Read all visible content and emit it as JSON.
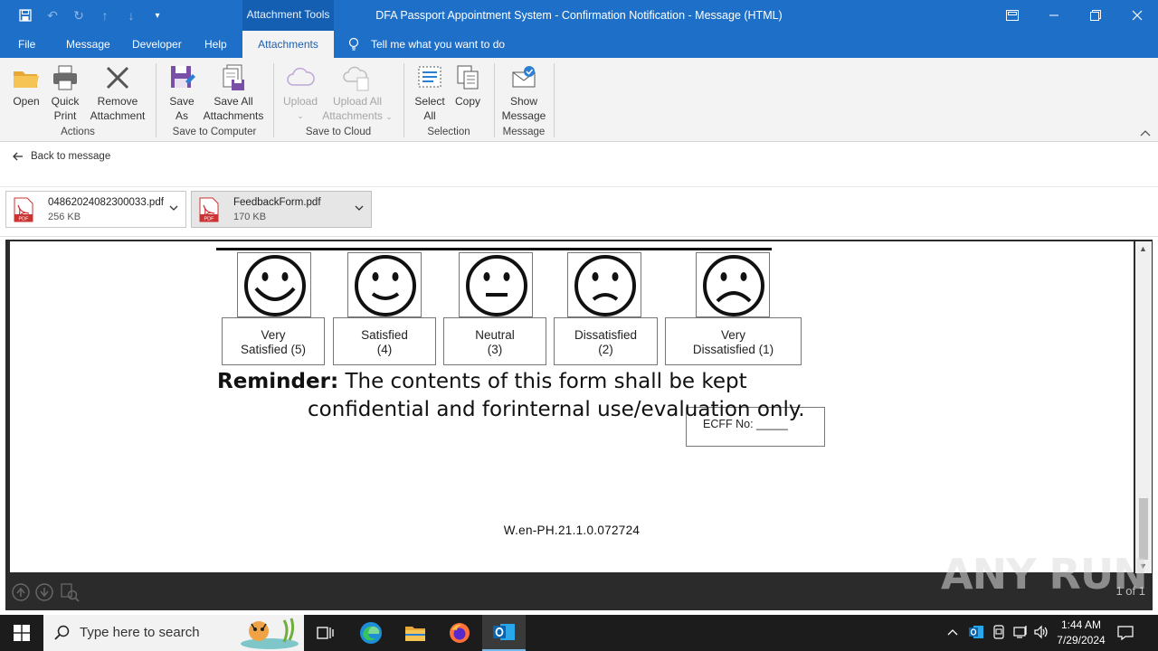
{
  "titlebar": {
    "context_tab": "Attachment Tools",
    "title": "DFA Passport Appointment System - Confirmation Notification  -  Message (HTML)"
  },
  "tabs": [
    {
      "label": "File"
    },
    {
      "label": "Message"
    },
    {
      "label": "Developer"
    },
    {
      "label": "Help"
    },
    {
      "label": "Attachments"
    }
  ],
  "tell_me": "Tell me what you want to do",
  "ribbon": {
    "buttons": {
      "open": "Open",
      "quick_print_1": "Quick",
      "quick_print_2": "Print",
      "remove_1": "Remove",
      "remove_2": "Attachment",
      "save_as_1": "Save",
      "save_as_2": "As",
      "save_all_1": "Save All",
      "save_all_2": "Attachments",
      "upload": "Upload",
      "upload_all_1": "Upload All",
      "upload_all_2": "Attachments",
      "select_all_1": "Select",
      "select_all_2": "All",
      "copy": "Copy",
      "show_message_1": "Show",
      "show_message_2": "Message"
    },
    "groups": {
      "actions": "Actions",
      "save_to_computer": "Save to Computer",
      "save_to_cloud": "Save to Cloud",
      "selection": "Selection",
      "message": "Message"
    }
  },
  "back_link": "Back to message",
  "attachments": [
    {
      "name": "04862024082300033.pdf",
      "size": "256 KB",
      "icon": "pdf-icon"
    },
    {
      "name": "FeedbackForm.pdf",
      "size": "170 KB",
      "icon": "pdf-icon"
    }
  ],
  "document": {
    "ratings": [
      {
        "line1": "Very",
        "line2": "Satisfied (5)",
        "face": "big-smile"
      },
      {
        "line1": "Satisfied",
        "line2": "(4)",
        "face": "smile"
      },
      {
        "line1": "Neutral",
        "line2": "(3)",
        "face": "neutral"
      },
      {
        "line1": "Dissatisfied",
        "line2": "(2)",
        "face": "frown"
      },
      {
        "line1": "Very",
        "line2": "Dissatisfied (1)",
        "face": "big-frown"
      }
    ],
    "reminder_bold": "Reminder:",
    "reminder_line1": " The contents of this form shall be kept",
    "reminder_line2": "confidential and forinternal use/evaluation only.",
    "ecff_label": "ECFF No: _____",
    "version": "W.en-PH.21.1.0.072724"
  },
  "preview": {
    "page_count": "1 of 1",
    "watermark": "ANY RUN"
  },
  "taskbar": {
    "search_placeholder": "Type here to search",
    "time": "1:44 AM",
    "date": "7/29/2024"
  }
}
